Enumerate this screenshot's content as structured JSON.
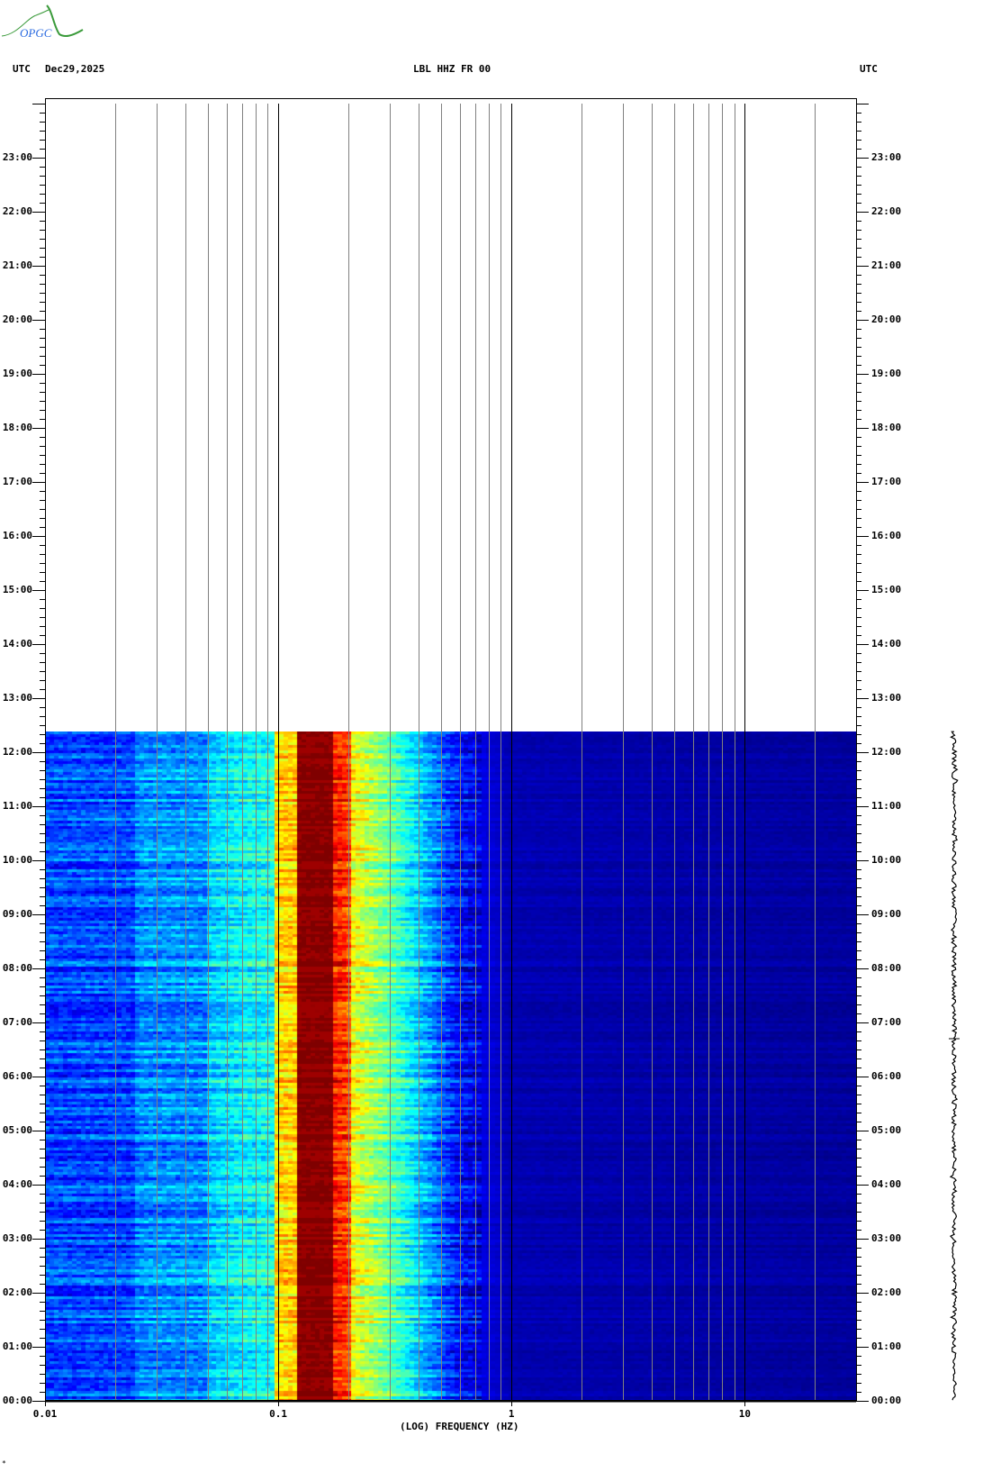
{
  "header": {
    "logo_text": "OPGC",
    "left_tz": "UTC",
    "date": "Dec29,2025",
    "station": "LBL HHZ FR 00",
    "right_tz": "UTC"
  },
  "footer_mark": "*",
  "chart_data": {
    "type": "heatmap",
    "title": "LBL HHZ FR 00",
    "xlabel": "(LOG) FREQUENCY (HZ)",
    "ylabel": "UTC",
    "x_scale": "log",
    "xlim": [
      0.01,
      30
    ],
    "ylim_hours": [
      0,
      24
    ],
    "data_end_hour": 12.38,
    "x_ticks": [
      {
        "value": 0.01,
        "label": "0.01"
      },
      {
        "value": 0.1,
        "label": "0.1"
      },
      {
        "value": 1,
        "label": "1"
      },
      {
        "value": 10,
        "label": "10"
      }
    ],
    "y_ticks": [
      "00:00",
      "01:00",
      "02:00",
      "03:00",
      "04:00",
      "05:00",
      "06:00",
      "07:00",
      "08:00",
      "09:00",
      "10:00",
      "11:00",
      "12:00",
      "13:00",
      "14:00",
      "15:00",
      "16:00",
      "17:00",
      "18:00",
      "19:00",
      "20:00",
      "21:00",
      "22:00",
      "23:00"
    ],
    "colormap": "jet",
    "spectral_profile": [
      {
        "f": 0.01,
        "level": 0.2
      },
      {
        "f": 0.024,
        "level": 0.2
      },
      {
        "f": 0.025,
        "level": 0.27
      },
      {
        "f": 0.049,
        "level": 0.27
      },
      {
        "f": 0.05,
        "level": 0.33
      },
      {
        "f": 0.07,
        "level": 0.38
      },
      {
        "f": 0.095,
        "level": 0.4
      },
      {
        "f": 0.097,
        "level": 0.66
      },
      {
        "f": 0.119,
        "level": 0.68
      },
      {
        "f": 0.12,
        "level": 1.0
      },
      {
        "f": 0.168,
        "level": 1.0
      },
      {
        "f": 0.17,
        "level": 0.86
      },
      {
        "f": 0.2,
        "level": 0.82
      },
      {
        "f": 0.21,
        "level": 0.62
      },
      {
        "f": 0.3,
        "level": 0.48
      },
      {
        "f": 0.4,
        "level": 0.34
      },
      {
        "f": 0.6,
        "level": 0.14
      },
      {
        "f": 1.0,
        "level": 0.05
      },
      {
        "f": 30,
        "level": 0.03
      }
    ]
  },
  "colors": {
    "grid_minor": "#808080",
    "grid_major": "#000000",
    "logo_green": "#3a9a3a",
    "logo_blue": "#2a6ae0"
  }
}
